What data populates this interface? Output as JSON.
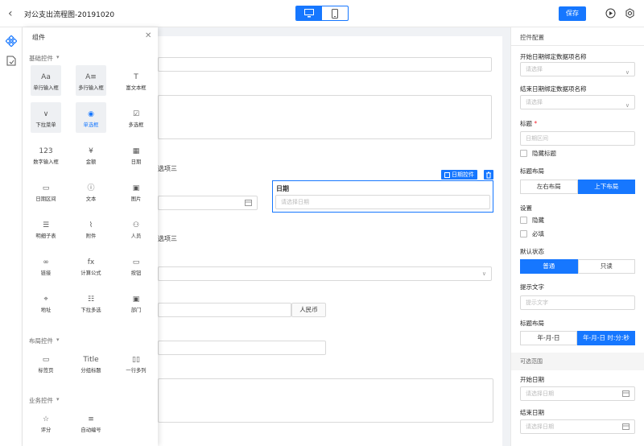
{
  "header": {
    "back_icon": "arrow-left-icon",
    "title": "对公支出流程图-20191020",
    "save_label": "保存"
  },
  "panel": {
    "title": "组件",
    "groups": [
      {
        "name": "基础控件",
        "items": [
          {
            "label": "单行输入框",
            "icon": "Aa",
            "selected": true
          },
          {
            "label": "多行输入框",
            "icon": "A≡",
            "selected": true
          },
          {
            "label": "富文本框",
            "icon": "T"
          },
          {
            "label": "下拉菜单",
            "icon": "∨",
            "selected": true
          },
          {
            "label": "单选框",
            "icon": "◉",
            "selected": true,
            "active": true
          },
          {
            "label": "多选框",
            "icon": "☑"
          },
          {
            "label": "数字输入框",
            "icon": "123"
          },
          {
            "label": "金额",
            "icon": "¥"
          },
          {
            "label": "日期",
            "icon": "▦"
          },
          {
            "label": "日期区间",
            "icon": "▭"
          },
          {
            "label": "文本",
            "icon": "ⓘ"
          },
          {
            "label": "图片",
            "icon": "▣"
          },
          {
            "label": "明细子表",
            "icon": "☰"
          },
          {
            "label": "附件",
            "icon": "⌇"
          },
          {
            "label": "人员",
            "icon": "⚇"
          },
          {
            "label": "链接",
            "icon": "∞"
          },
          {
            "label": "计算公式",
            "icon": "fx"
          },
          {
            "label": "按钮",
            "icon": "▭"
          },
          {
            "label": "地址",
            "icon": "⌖"
          },
          {
            "label": "下拉多选",
            "icon": "☷"
          },
          {
            "label": "部门",
            "icon": "▣"
          }
        ]
      },
      {
        "name": "布局控件",
        "items": [
          {
            "label": "标签页",
            "icon": "▭"
          },
          {
            "label": "分组标题",
            "icon": "Title"
          },
          {
            "label": "一行多列",
            "icon": "▯▯"
          }
        ]
      },
      {
        "name": "业务控件",
        "items": [
          {
            "label": "评分",
            "icon": "☆"
          },
          {
            "label": "自动编号",
            "icon": "≡"
          }
        ]
      }
    ]
  },
  "canvas": {
    "option_three_a": "选项三",
    "option_three_b": "选项三",
    "date_label": "日期",
    "date_placeholder": "请选择日期",
    "date_widget_tag": "日期控件",
    "currency_label": "人民币"
  },
  "right": {
    "title": "控件配置",
    "start_bind_label": "开始日期绑定数据项名称",
    "start_bind_placeholder": "请选择",
    "end_bind_label": "结束日期绑定数据项名称",
    "end_bind_placeholder": "请选择",
    "title_label": "标题",
    "required_mark": "*",
    "title_placeholder": "日期区间",
    "hide_title": "隐藏标题",
    "title_layout_label": "标题布局",
    "layout_lr": "左右布局",
    "layout_tb": "上下布局",
    "settings_label": "设置",
    "hide": "隐藏",
    "required": "必填",
    "default_state_label": "默认状态",
    "state_normal": "普通",
    "state_readonly": "只读",
    "hint_label": "提示文字",
    "hint_placeholder": "提示文字",
    "format_label": "标题布局",
    "fmt_date": "年-月-日",
    "fmt_datetime": "年-月-日 时:分:秒",
    "range_section": "可选范围",
    "start_date_label": "开始日期",
    "start_date_placeholder": "请选择日期",
    "end_date_label": "结束日期",
    "end_date_placeholder": "请选择日期"
  },
  "colors": {
    "accent": "#1677ff"
  }
}
